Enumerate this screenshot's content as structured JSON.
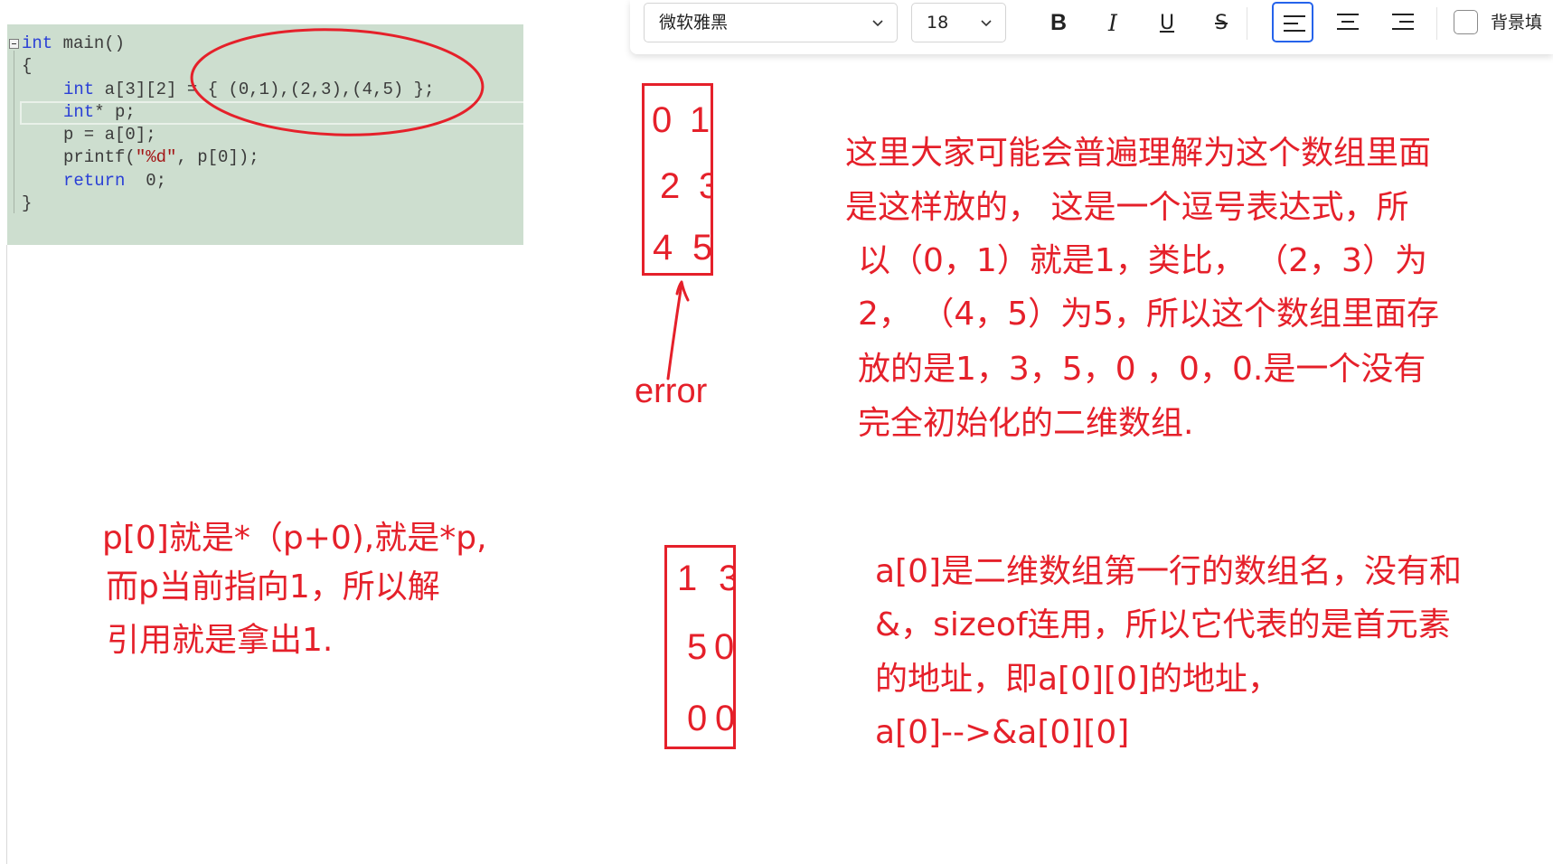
{
  "toolbar": {
    "font_family": "微软雅黑",
    "font_size": "18",
    "bold": "B",
    "italic": "I",
    "underline": "U",
    "strikethrough": "S",
    "background_fill_label": "背景填",
    "background_fill_checked": false,
    "accent_color": "#2563eb",
    "icons": [
      "chevron-down-icon",
      "align-left-icon",
      "align-center-icon",
      "align-right-icon"
    ],
    "selected_alignment_icon": "align-left-icon"
  },
  "code": {
    "background_color": "#cddecf",
    "keyword_color": "#2a3fd6",
    "fold_icon": "collapse-box-icon",
    "lines": [
      {
        "kw": "int",
        "rest": " main()"
      },
      {
        "rest": "{"
      },
      {
        "kw": "int",
        "rest": " a[3][2] = { (0,1),(2,3),(4,5) };"
      },
      {
        "kw": "int",
        "rest": "* p;"
      },
      {
        "rest": "p = a[0];"
      },
      {
        "pre": "printf(",
        "str": "\"%d\"",
        "rest": ", p[0]);"
      },
      {
        "kw": "return",
        "rest": "  0;"
      },
      {
        "rest": "}"
      }
    ]
  },
  "annotations": {
    "ink_color": "#e5202a",
    "error_label": "error",
    "matrix_before": [
      [
        "0",
        "1"
      ],
      [
        "2",
        "3"
      ],
      [
        "4",
        "5"
      ]
    ],
    "matrix_after": [
      [
        "1",
        "3"
      ],
      [
        "5",
        "0"
      ],
      [
        "0",
        "0"
      ]
    ],
    "note_comma_expression": [
      "这里大家可能会普遍理解为这个数组里面",
      "是这样放的， 这是一个逗号表达式，所",
      "以（0，1）就是1，类比， （2，3）为",
      "2， （4，5）为5，所以这个数组里面存",
      "放的是1，3，5，0 ，0，0.是一个没有",
      "完全初始化的二维数组."
    ],
    "note_pointer_deref": [
      "p[0]就是*（p+0),就是*p,",
      "而p当前指向1，所以解",
      "引用就是拿出1."
    ],
    "note_row_name": [
      "a[0]是二维数组第一行的数组名，没有和",
      "&，sizeof连用，所以它代表的是首元素",
      "的地址，即a[0][0]的地址，",
      "a[0]-->&a[0][0]"
    ]
  }
}
